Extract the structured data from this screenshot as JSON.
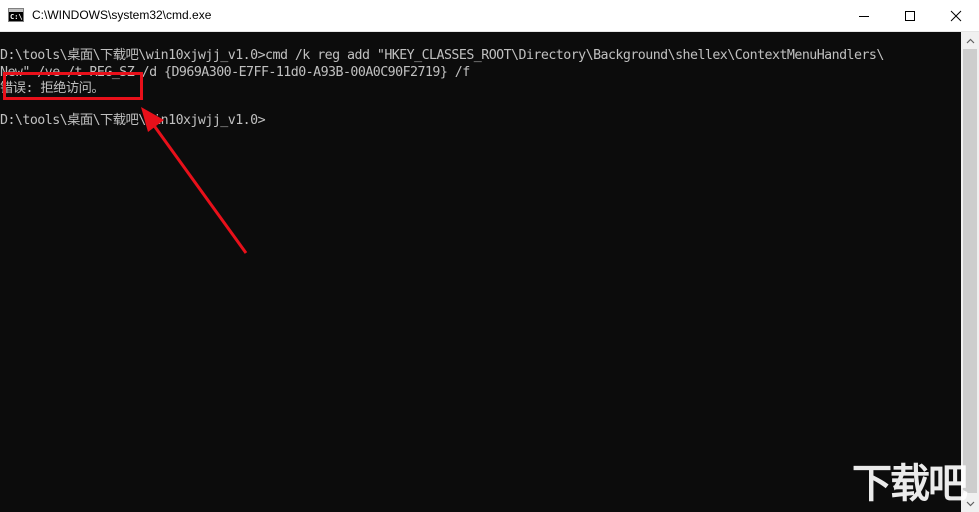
{
  "window": {
    "title": "C:\\WINDOWS\\system32\\cmd.exe",
    "icon": "cmd-icon",
    "icon_glyph": "C:\\"
  },
  "console": {
    "lines": [
      "D:\\tools\\桌面\\下载吧\\win10xjwjj_v1.0>cmd /k reg add \"HKEY_CLASSES_ROOT\\Directory\\Background\\shellex\\ContextMenuHandlers\\",
      "New\" /ve /t REG_SZ /d {D969A300-E7FF-11d0-A93B-00A0C90F2719} /f",
      "错误: 拒绝访问。",
      "D:\\tools\\桌面\\下载吧\\win10xjwjj_v1.0>"
    ],
    "text_color": "#c0c0c0",
    "background": "#0c0c0c"
  },
  "annotation": {
    "color": "#e8101a"
  },
  "watermark": {
    "text": "下载吧"
  }
}
